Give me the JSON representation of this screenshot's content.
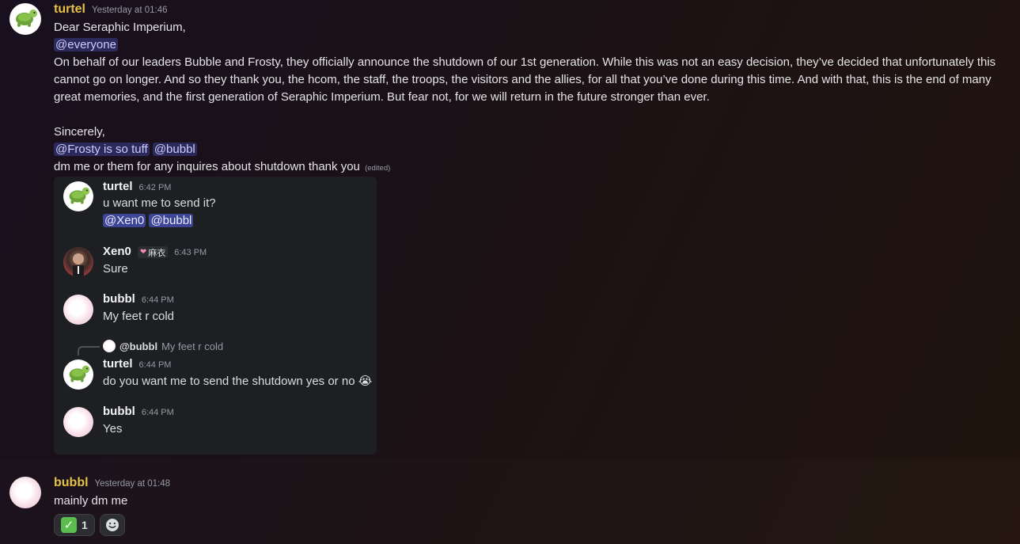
{
  "message1": {
    "author": "turtel",
    "timestamp": "Yesterday at 01:46",
    "greeting": "Dear Seraphic Imperium,",
    "mention_everyone": "@everyone",
    "body": "On behalf of our leaders Bubble and Frosty, they officially announce the shutdown of our 1st generation. While this was not an easy decision, they’ve decided that unfortunately this cannot go on longer. And so they thank you, the hcom, the staff, the troops, the visitors and the allies, for all that you’ve done during this time. And with that, this is the end of many great memories, and the first generation of Seraphic Imperium. But fear not, for we will return in the future stronger than ever.",
    "signoff": "Sincerely,",
    "mention_frosty": "@Frosty is so tuff",
    "mention_bubbl": "@bubbl",
    "footer": "dm me or them for any inquires about shutdown thank you",
    "edited": "(edited)"
  },
  "embed": {
    "messages": [
      {
        "author": "turtel",
        "time": "6:42 PM",
        "text": "u want me to send it?",
        "mention1": "@Xen0",
        "mention2": "@bubbl"
      },
      {
        "author": "Xen0",
        "tag": "麻衣",
        "time": "6:43 PM",
        "text": "Sure"
      },
      {
        "author": "bubbl",
        "time": "6:44 PM",
        "text": "My feet r cold"
      },
      {
        "author": "turtel",
        "time": "6:44 PM",
        "text": "do you want me to send the shutdown yes or no 😭"
      },
      {
        "author": "bubbl",
        "time": "6:44 PM",
        "text": "Yes"
      }
    ],
    "reply": {
      "name": "@bubbl",
      "text": "My feet r cold"
    }
  },
  "message2": {
    "author": "bubbl",
    "timestamp": "Yesterday at 01:48",
    "text": "mainly dm me",
    "reaction_check": "✅",
    "reaction_count": "1",
    "add_reaction_icon": "smiley-icon"
  }
}
